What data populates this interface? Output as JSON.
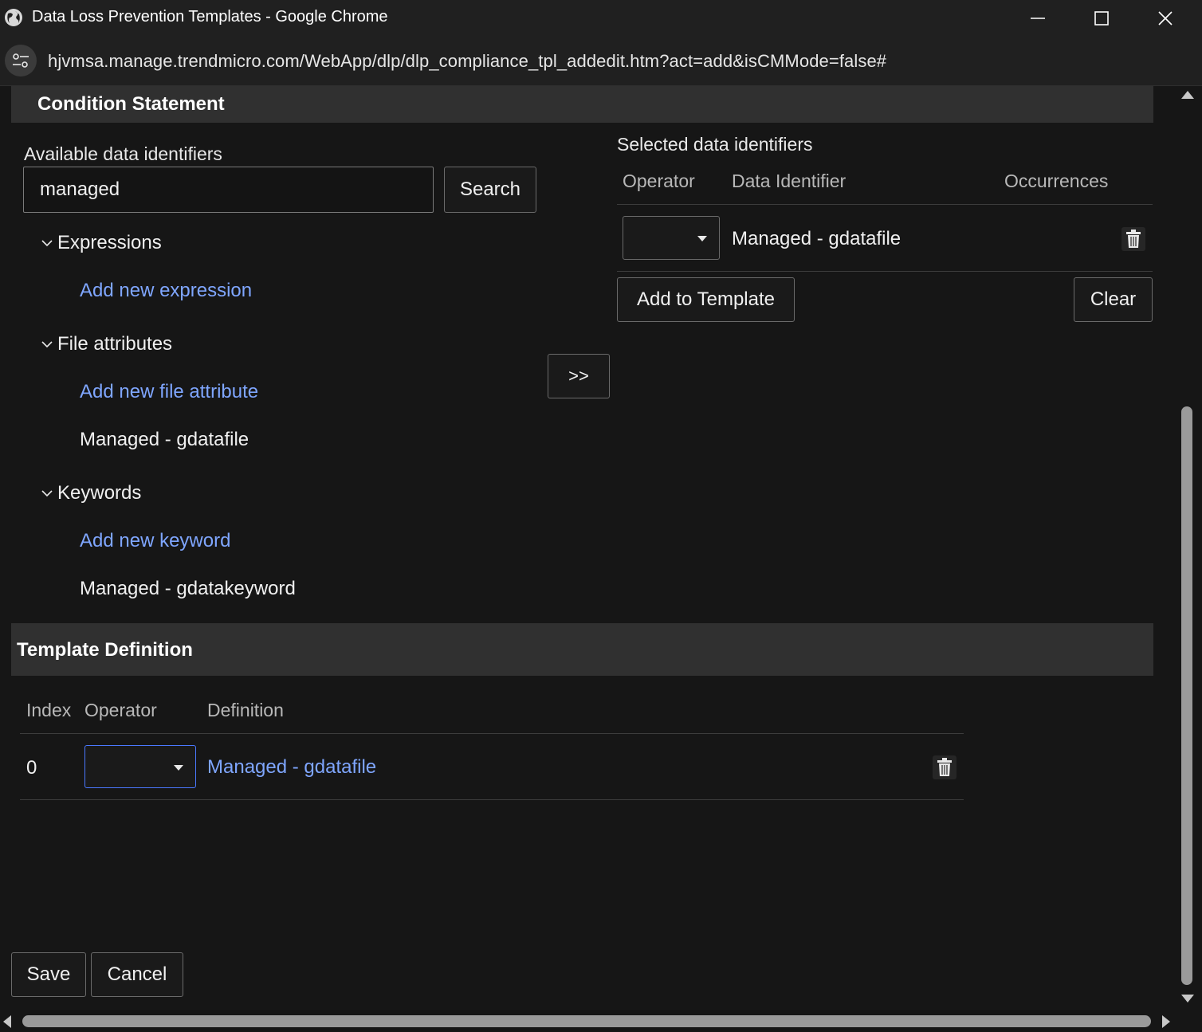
{
  "window": {
    "title": "Data Loss Prevention Templates - Google Chrome",
    "url": "hjvmsa.manage.trendmicro.com/WebApp/dlp/dlp_compliance_tpl_addedit.htm?act=add&isCMMode=false#"
  },
  "condition": {
    "header": "Condition Statement",
    "available_label": "Available data identifiers",
    "search_value": "managed",
    "search_button": "Search",
    "groups": [
      {
        "name": "Expressions",
        "add_link": "Add new expression",
        "items": []
      },
      {
        "name": "File attributes",
        "add_link": "Add new file attribute",
        "items": [
          "Managed - gdatafile"
        ]
      },
      {
        "name": "Keywords",
        "add_link": "Add new keyword",
        "items": [
          "Managed - gdatakeyword"
        ]
      }
    ],
    "move_button": ">>",
    "selected_label": "Selected data identifiers",
    "selected_columns": {
      "operator": "Operator",
      "identifier": "Data Identifier",
      "occurrences": "Occurrences"
    },
    "selected_rows": [
      {
        "operator": "",
        "identifier": "Managed - gdatafile"
      }
    ],
    "add_to_template_button": "Add to Template",
    "clear_button": "Clear"
  },
  "template": {
    "header": "Template Definition",
    "columns": {
      "index": "Index",
      "operator": "Operator",
      "definition": "Definition"
    },
    "rows": [
      {
        "index": "0",
        "operator": "",
        "definition": "Managed - gdatafile"
      }
    ]
  },
  "footer": {
    "save": "Save",
    "cancel": "Cancel"
  },
  "colors": {
    "link": "#7fa6ff",
    "header_bg": "#303030",
    "focus": "#4a78ff",
    "page_bg": "#161616"
  }
}
